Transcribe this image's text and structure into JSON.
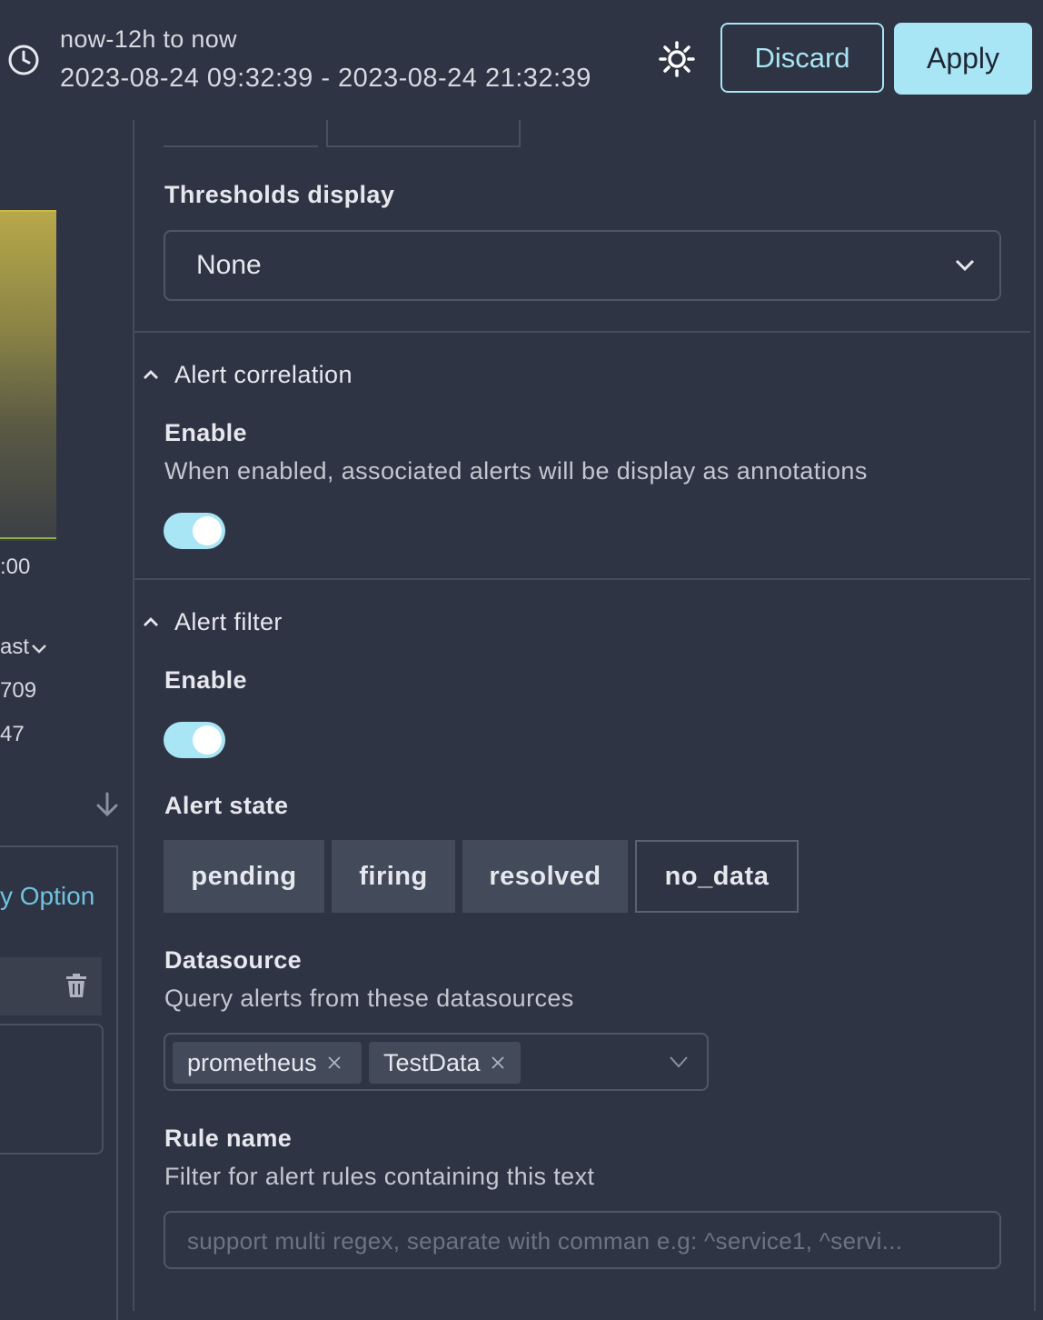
{
  "header": {
    "range_title": "now-12h to now",
    "range_sub": "2023-08-24 09:32:39 - 2023-08-24 21:32:39",
    "discard_label": "Discard",
    "apply_label": "Apply",
    "icons": [
      "clock-icon",
      "sun-icon"
    ]
  },
  "left_panel": {
    "tick_label": ":00",
    "legend_header": "ast",
    "legend_values": [
      "709",
      "47"
    ],
    "option_link": "y Option"
  },
  "thresholds": {
    "label": "Thresholds display",
    "selected": "None"
  },
  "alert_correlation": {
    "title": "Alert correlation",
    "enable_label": "Enable",
    "enable_desc": "When enabled, associated alerts will be display as annotations",
    "enabled": true
  },
  "alert_filter": {
    "title": "Alert filter",
    "enable_label": "Enable",
    "enabled": true,
    "state_label": "Alert state",
    "states": [
      {
        "label": "pending",
        "selected": true
      },
      {
        "label": "firing",
        "selected": true
      },
      {
        "label": "resolved",
        "selected": true
      },
      {
        "label": "no_data",
        "selected": false
      }
    ],
    "datasource_label": "Datasource",
    "datasource_desc": "Query alerts from these datasources",
    "datasources": [
      "prometheus",
      "TestData"
    ],
    "rule_label": "Rule name",
    "rule_desc": "Filter for alert rules containing this text",
    "rule_placeholder": "support multi regex, separate with comman e.g: ^service1, ^servi..."
  },
  "colors": {
    "accent": "#a8e5f5",
    "background": "#2e3443",
    "link": "#6fc3e0"
  }
}
